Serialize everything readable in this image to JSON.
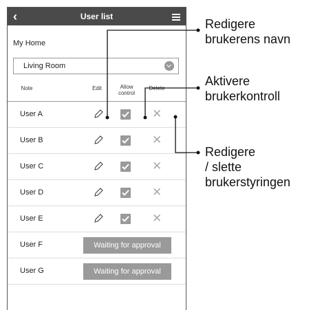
{
  "header": {
    "back_icon": "chevron-left-icon",
    "title": "User list",
    "menu_icon": "hamburger-icon"
  },
  "home_label": "My Home",
  "room_select": {
    "value": "Living Room",
    "icon": "chevron-down-circle-icon"
  },
  "columns": {
    "note": "Note",
    "edit": "Edit",
    "allow_line1": "Allow",
    "allow_line2": "control",
    "delete": "Delete"
  },
  "users": [
    {
      "name": "User A"
    },
    {
      "name": "User B"
    },
    {
      "name": "User C"
    },
    {
      "name": "User D"
    },
    {
      "name": "User E"
    },
    {
      "name": "User F",
      "status": "Waiting for approval"
    },
    {
      "name": "User G",
      "status": "Waiting for approval"
    }
  ],
  "callouts": {
    "edit_name_line1": "Redigere",
    "edit_name_line2": "brukerens navn",
    "activate_line1": "Aktivere",
    "activate_line2": "brukerkontroll",
    "manage_line1": "Redigere",
    "manage_line2": "/ slette",
    "manage_line3": "brukerstyringen"
  },
  "colors": {
    "topbar": "#4a4a4a",
    "button_gray": "#9a9a9a"
  }
}
